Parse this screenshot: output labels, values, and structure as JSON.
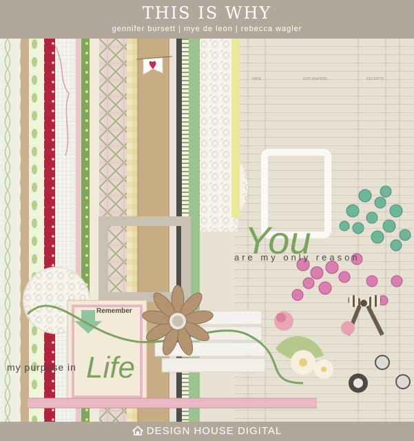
{
  "header": {
    "title": "THIS IS WHY",
    "credits": "gennifer bursett | mye de leon | rebecca wagler"
  },
  "ledger": {
    "col_date": "DATE",
    "col_explanation": "EXPLANATION",
    "col_receipts": "RECEIPTS"
  },
  "word_art": {
    "you": "You",
    "are_my_only_reason": "are my only reason",
    "my_purpose_in": "my purpose in",
    "life": "Life",
    "remember": "Remember"
  },
  "footer": {
    "brand": "DESIGN HOUSE DIGITAL"
  },
  "colors": {
    "header_bg": "#b1a89b",
    "green": "#7aa360",
    "pink": "#d97fb0",
    "red": "#b0243d",
    "kraft": "#c9b28d",
    "mint": "#6fb59a"
  }
}
